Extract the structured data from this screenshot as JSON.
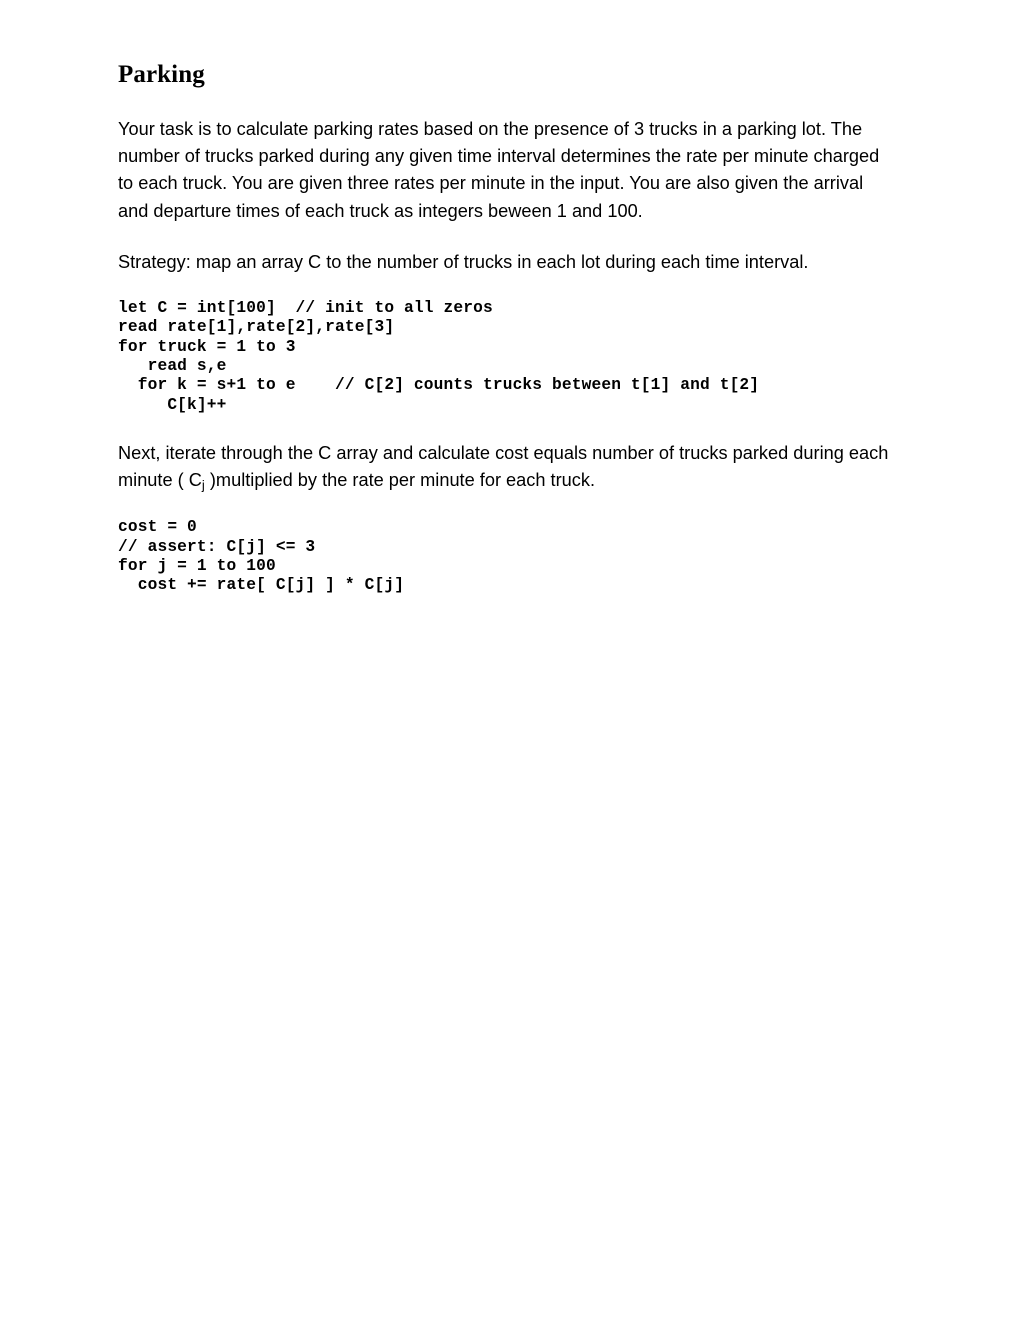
{
  "document": {
    "title": "Parking",
    "paragraphs": {
      "intro": "Your task is to calculate parking rates based on the presence of 3 trucks in a parking lot. The number of trucks parked during any given time interval determines the rate per minute charged to each truck. You are given three rates per minute in the input. You are also given the arrival and departure times of each truck as integers beween 1 and 100.",
      "strategy": "Strategy: map an array C to the number of trucks in each lot during each time interval.",
      "next_prefix": "Next, iterate through the C array and calculate cost equals number of trucks parked during each minute ( C",
      "next_subscript": "j",
      "next_suffix": " )multiplied by the rate per minute for each truck."
    },
    "code_blocks": {
      "first": "let C = int[100]  // init to all zeros\nread rate[1],rate[2],rate[3]\nfor truck = 1 to 3\n   read s,e\n  for k = s+1 to e    // C[2] counts trucks between t[1] and t[2]\n     C[k]++",
      "second": "cost = 0\n// assert: C[j] <= 3\nfor j = 1 to 100\n  cost += rate[ C[j] ] * C[j]"
    }
  }
}
